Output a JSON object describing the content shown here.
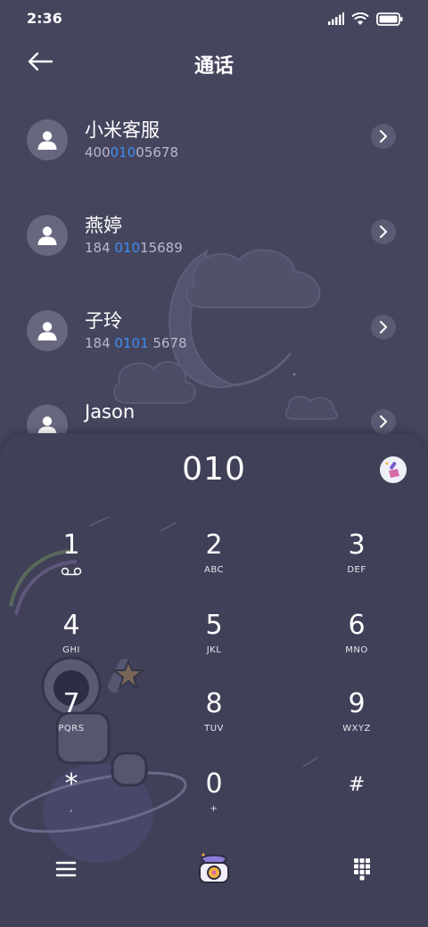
{
  "status_bar": {
    "time": "2:36"
  },
  "app_bar": {
    "title": "通话"
  },
  "contacts": [
    {
      "name": "小米客服",
      "number_parts": [
        "400",
        "010",
        "05678"
      ]
    },
    {
      "name": "燕婷",
      "number_parts": [
        "184 ",
        "010",
        "15689"
      ]
    },
    {
      "name": "子玲",
      "number_parts": [
        "184 ",
        "0101",
        " 5678"
      ]
    },
    {
      "name": "Jason",
      "number_parts": [
        "",
        "",
        ""
      ]
    }
  ],
  "dialpad": {
    "typed_number": "010",
    "keys": [
      {
        "digit": "1",
        "letters": ""
      },
      {
        "digit": "2",
        "letters": "ABC"
      },
      {
        "digit": "3",
        "letters": "DEF"
      },
      {
        "digit": "4",
        "letters": "GHI"
      },
      {
        "digit": "5",
        "letters": "JKL"
      },
      {
        "digit": "6",
        "letters": "MNO"
      },
      {
        "digit": "7",
        "letters": "PQRS"
      },
      {
        "digit": "8",
        "letters": "TUV"
      },
      {
        "digit": "9",
        "letters": "WXYZ"
      },
      {
        "digit": "*",
        "letters": ","
      },
      {
        "digit": "0",
        "letters": "+"
      },
      {
        "digit": "#",
        "letters": ""
      }
    ]
  },
  "colors": {
    "highlight": "#3f8cf0",
    "background": "#45455e",
    "dialpad_bg": "#404058"
  },
  "icons": {
    "back": "arrow-left-icon",
    "signal": "signal-icon",
    "wifi": "wifi-icon",
    "battery": "battery-icon",
    "menu": "menu-icon",
    "call": "telephone-icon",
    "keypad": "keypad-grid-icon",
    "clean": "broom-icon",
    "voicemail": "voicemail-icon"
  }
}
